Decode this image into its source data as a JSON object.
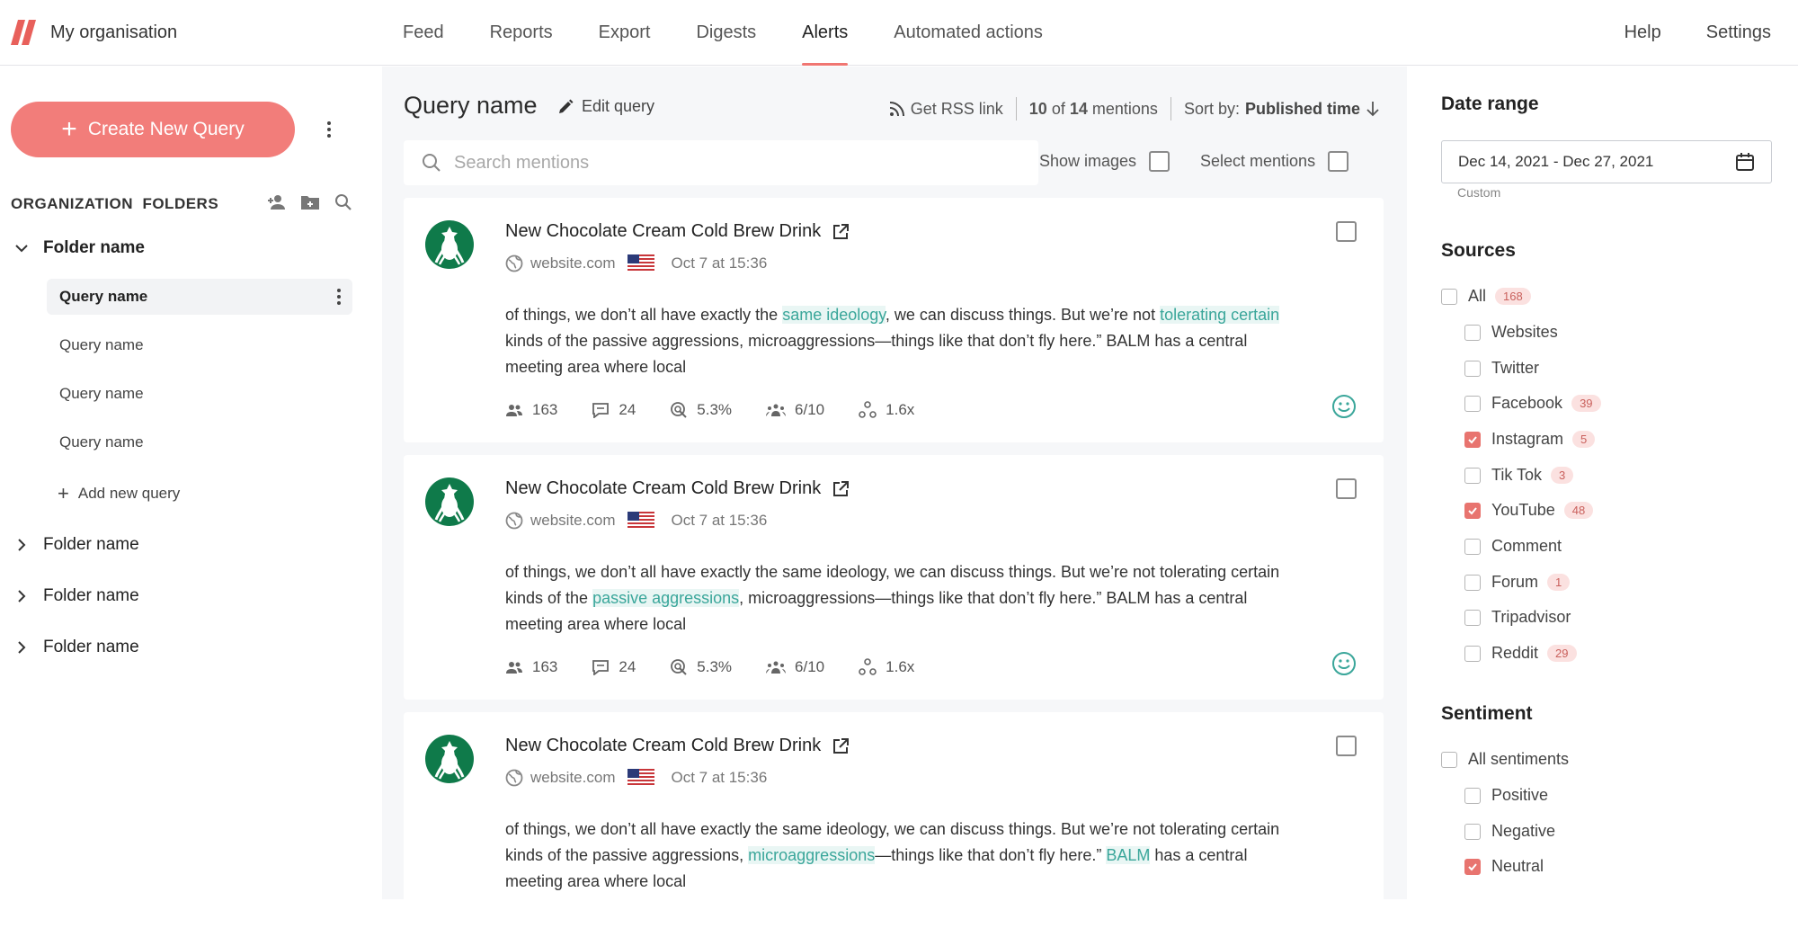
{
  "app": {
    "org_name": "My organisation"
  },
  "nav": {
    "tabs": [
      {
        "label": "Feed"
      },
      {
        "label": "Reports"
      },
      {
        "label": "Export"
      },
      {
        "label": "Digests"
      },
      {
        "label": "Alerts",
        "active": true
      },
      {
        "label": "Automated actions"
      }
    ],
    "help": "Help",
    "settings": "Settings"
  },
  "sidebar": {
    "create_label": "Create New Query",
    "org_folders": "ORGANIZATION  FOLDERS",
    "folders": [
      {
        "name": "Folder name",
        "expanded": true
      },
      {
        "name": "Folder name"
      },
      {
        "name": "Folder name"
      },
      {
        "name": "Folder name"
      }
    ],
    "queries": [
      "Query name",
      "Query name",
      "Query name",
      "Query name"
    ],
    "add_query": "Add new query"
  },
  "header": {
    "title": "Query name",
    "edit": "Edit query",
    "rss": "Get RSS link",
    "count_shown": "10",
    "count_of": "of",
    "count_total": "14",
    "count_unit": "mentions",
    "sort_label": "Sort by:",
    "sort_value": "Published time"
  },
  "search": {
    "placeholder": "Search mentions"
  },
  "toggles": {
    "show_images": "Show images",
    "select_mentions": "Select mentions"
  },
  "mentions": [
    {
      "title": "New Chocolate Cream Cold Brew Drink",
      "site": "website.com",
      "date": "Oct 7 at 15:36",
      "t1": "of things, we don’t all have exactly the ",
      "h1": "same ideology",
      "t2": ", we can discuss things. But we’re not ",
      "h2": "tolerating certain",
      "t3": " kinds of the passive aggressions, microaggressions—things like that don’t fly here.” BALM has a central meeting area where local",
      "reach": "163",
      "comments": "24",
      "engagement": "5.3%",
      "influence": "6/10",
      "virality": "1.6x"
    },
    {
      "title": "New Chocolate Cream Cold Brew Drink",
      "site": "website.com",
      "date": "Oct 7 at 15:36",
      "t1": "of things, we don’t all have exactly the same ideology, we can discuss things. But we’re not tolerating certain kinds of the ",
      "h1": "passive aggressions",
      "t2": ", microaggressions—things like that don’t fly here.” BALM has a central meeting area where local",
      "reach": "163",
      "comments": "24",
      "engagement": "5.3%",
      "influence": "6/10",
      "virality": "1.6x"
    },
    {
      "title": "New Chocolate Cream Cold Brew Drink",
      "site": "website.com",
      "date": "Oct 7 at 15:36",
      "t1": "of things, we don’t all have exactly the same ideology, we can discuss things. But we’re not tolerating certain kinds of the passive aggressions, ",
      "h1": "microaggressions",
      "t2": "—things like that don’t fly here.” ",
      "h2": "BALM",
      "t3": " has a central meeting area where local"
    }
  ],
  "filters": {
    "date_title": "Date range",
    "date_value": "Dec 14, 2021 - Dec 27, 2021",
    "date_note": "Custom",
    "sources_title": "Sources",
    "sources_all": "All",
    "sources_all_count": "168",
    "sources": [
      {
        "label": "Websites",
        "checked": false
      },
      {
        "label": "Twitter",
        "checked": false
      },
      {
        "label": "Facebook",
        "count": "39",
        "checked": false
      },
      {
        "label": "Instagram",
        "count": "5",
        "checked": true
      },
      {
        "label": "Tik Tok",
        "count": "3",
        "checked": false
      },
      {
        "label": "YouTube",
        "count": "48",
        "checked": true
      },
      {
        "label": "Comment",
        "checked": false
      },
      {
        "label": "Forum",
        "count": "1",
        "checked": false
      },
      {
        "label": "Tripadvisor",
        "checked": false
      },
      {
        "label": "Reddit",
        "count": "29",
        "checked": false
      }
    ],
    "sentiment_title": "Sentiment",
    "sentiment_all": "All sentiments",
    "sentiments": [
      {
        "label": "Positive",
        "checked": false
      },
      {
        "label": "Negative",
        "checked": false
      },
      {
        "label": "Neutral",
        "checked": true
      }
    ]
  },
  "colors": {
    "accent": "#f27d7a",
    "highlight": "#3aa69a",
    "brand_green": "#0f7a4a"
  }
}
